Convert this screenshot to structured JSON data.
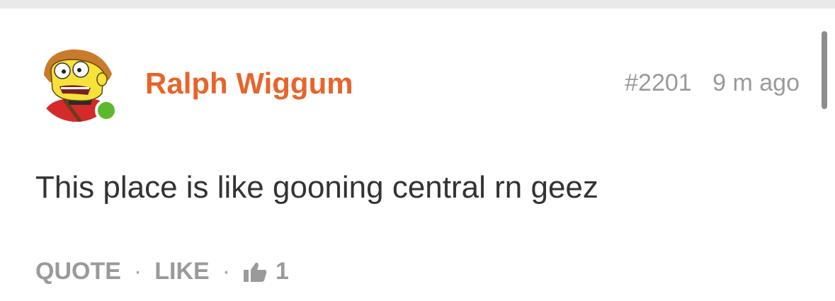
{
  "post": {
    "author": "Ralph Wiggum",
    "post_number": "#2201",
    "time_ago": "9 m ago",
    "content": "This place is like gooning central rn geez",
    "actions": {
      "quote_label": "QUOTE",
      "like_label": "LIKE",
      "like_count": "1"
    },
    "avatar_icon": "ralph-wiggum-avatar",
    "online_status": "online"
  },
  "colors": {
    "author": "#e8642a",
    "online": "#5cb82c",
    "muted": "#9a9a9a",
    "text": "#333333"
  }
}
